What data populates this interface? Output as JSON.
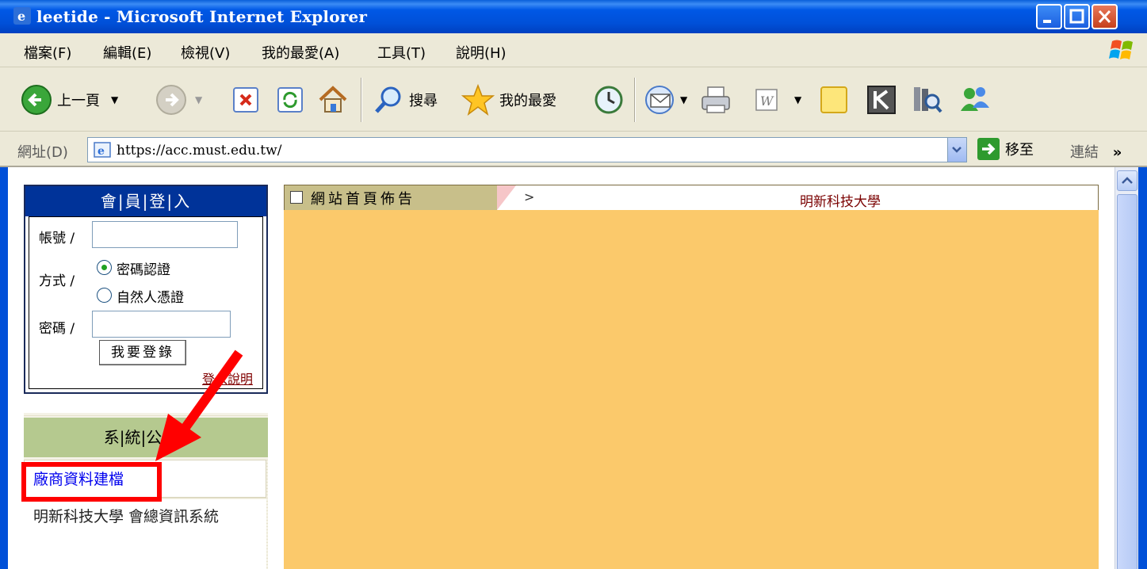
{
  "window": {
    "title": "leetide - Microsoft Internet Explorer"
  },
  "menu": {
    "items": [
      "檔案(F)",
      "編輯(E)",
      "檢視(V)",
      "我的最愛(A)",
      "工具(T)",
      "說明(H)"
    ]
  },
  "toolbar": {
    "back_label": "上一頁",
    "search_label": "搜尋",
    "favorites_label": "我的最愛"
  },
  "address": {
    "label": "網址(D)",
    "url": "https://acc.must.edu.tw/",
    "go_label": "移至",
    "links_label": "連結"
  },
  "login": {
    "header": "會|員|登|入",
    "account_label": "帳號 /",
    "account_value": "",
    "method_label": "方式 /",
    "method_options": [
      "密碼認證",
      "自然人憑證"
    ],
    "method_selected": "密碼認證",
    "password_label": "密碼 /",
    "password_value": "",
    "submit_label": "我要登錄",
    "help_link": "登入說明"
  },
  "announcements": {
    "header": "系|統|公|告.",
    "link": "廠商資料建檔",
    "text": "明新科技大學 會總資訊系統"
  },
  "banner": {
    "tab_label": "網站首頁佈告",
    "crumb": ">",
    "school": "明新科技大學"
  },
  "colors": {
    "title_bar": "#0050d8",
    "login_header": "#003399",
    "announcement_header": "#b5c98f",
    "main_area": "#fbc96b",
    "highlight": "#ff0000",
    "link": "#0000ee"
  }
}
